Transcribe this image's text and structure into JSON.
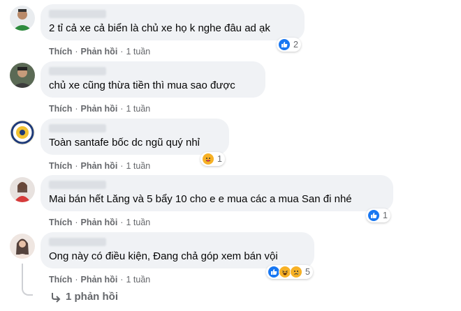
{
  "comments": [
    {
      "text": "2 tỉ cả xe cả biển là chủ xe họ k nghe đâu ad ạk",
      "like": "Thích",
      "reply": "Phản hồi",
      "time": "1 tuần",
      "reaction_icons": [
        "like-icon"
      ],
      "reaction_count": "2"
    },
    {
      "text": "chủ xe cũng thừa tiền thì mua sao được",
      "like": "Thích",
      "reply": "Phản hồi",
      "time": "1 tuần",
      "reaction_icons": [],
      "reaction_count": ""
    },
    {
      "text": "Toàn santafe bốc dc ngũ quý nhỉ",
      "like": "Thích",
      "reply": "Phản hồi",
      "time": "1 tuần",
      "reaction_icons": [
        "care-icon"
      ],
      "reaction_count": "1"
    },
    {
      "text": "Mai bán hết Lăng và 5 bẩy 10 cho e e mua các a mua San đi nhé",
      "like": "Thích",
      "reply": "Phản hồi",
      "time": "1 tuần",
      "reaction_icons": [
        "like-icon"
      ],
      "reaction_count": "1"
    },
    {
      "text": "Ong này có điều kiện, Đang chả góp xem bán vội",
      "like": "Thích",
      "reply": "Phản hồi",
      "time": "1 tuần",
      "reaction_icons": [
        "like-icon",
        "haha-icon",
        "sad-icon"
      ],
      "reaction_count": "5"
    }
  ],
  "replies_link": {
    "label": "1 phản hồi",
    "icon": "reply-arrow-icon"
  },
  "colors": {
    "bubble": "#f0f2f5",
    "meta": "#65676b",
    "like": "#1877f2",
    "emoji": "#f7b125"
  }
}
